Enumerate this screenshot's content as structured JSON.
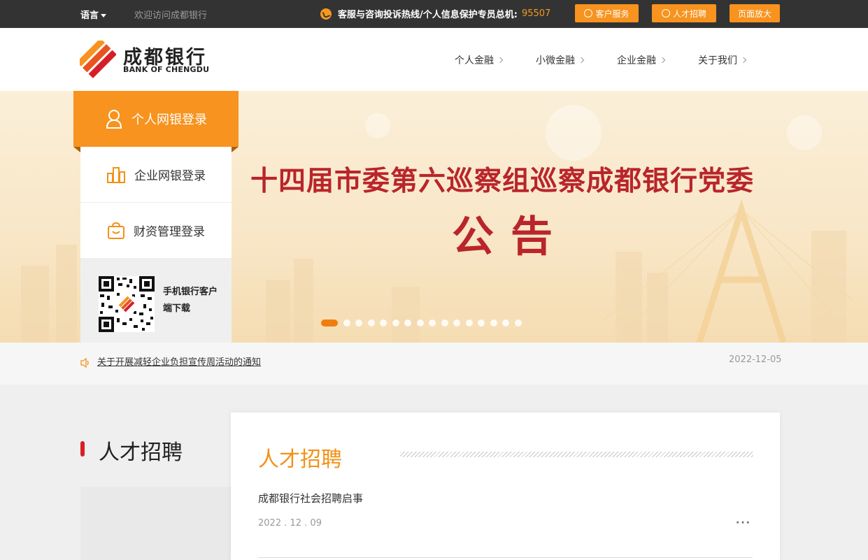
{
  "topbar": {
    "language": "语言",
    "welcome": "欢迎访问成都银行",
    "hotline_label": "客服与咨询投诉热线/个人信息保护专员总机:",
    "hotline_number": "95507",
    "buttons": {
      "service": "客户服务",
      "jobs": "人才招聘",
      "zoom": "页面放大"
    }
  },
  "header": {
    "logo_name": "成都银行",
    "logo_sub": "BANK OF CHENGDU",
    "nav": [
      "个人金融",
      "小微金融",
      "企业金融",
      "关于我们"
    ]
  },
  "banner": {
    "title": "十四届市委第六巡察组巡察成都银行党委",
    "subtitle": "公告",
    "slide_count": 16,
    "active_slide": 1
  },
  "login": {
    "personal": "个人网银登录",
    "enterprise": "企业网银登录",
    "wealth": "财资管理登录",
    "mobile_download": "手机银行客户端下载"
  },
  "notice": {
    "text": "关于开展减轻企业负担宣传周活动的通知",
    "date": "2022-12-05"
  },
  "section": {
    "title": "人才招聘",
    "card_title": "人才招聘",
    "item_title": "成都银行社会招聘启事",
    "item_date": "2022 . 12 . 09",
    "more": "···"
  },
  "colors": {
    "accent": "#f7931e",
    "brand_red": "#b9252a",
    "topbar_bg": "#333333"
  }
}
